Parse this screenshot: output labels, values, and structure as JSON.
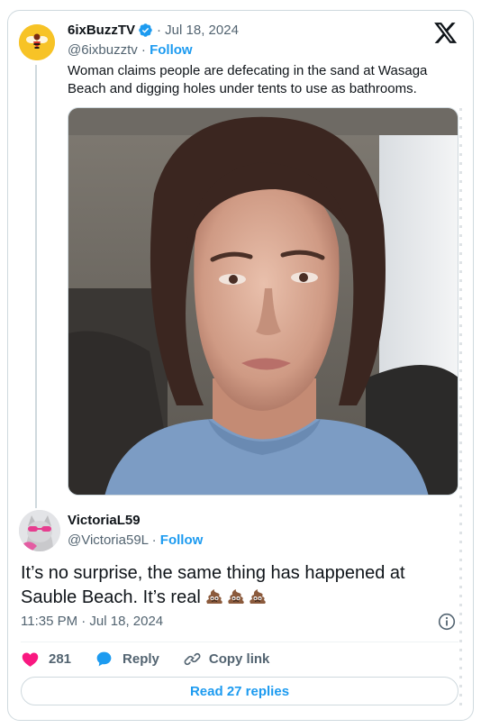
{
  "quoted": {
    "author_name": "6ixBuzzTV",
    "date_meta": "· Jul 18, 2024",
    "handle": "@6ixbuzztv",
    "dot": " · ",
    "follow_label": "Follow",
    "text": "Woman claims people are defecating in the sand at Wasaga Beach and digging holes under tents to use as bathrooms.",
    "avatar_icon": "bee-icon",
    "badge_icon": "verified-badge-icon"
  },
  "tweet": {
    "author_name": "VictoriaL59",
    "handle": "@Victoria59L",
    "dot": " · ",
    "follow_label": "Follow",
    "text": "It’s no surprise, the same thing has happened at Sauble Beach. It’s real",
    "emoji": [
      "pile-of-poo-icon",
      "pile-of-poo-icon",
      "pile-of-poo-icon"
    ],
    "timestamp": "11:35 PM · Jul 18, 2024"
  },
  "actions": {
    "like_count": "281",
    "reply_label": "Reply",
    "copy_label": "Copy link"
  },
  "footer": {
    "read_replies_label": "Read 27 replies"
  },
  "colors": {
    "accent": "#1d9bf0",
    "like": "#f91880",
    "text_primary": "#0f1419",
    "text_secondary": "#536471",
    "border": "#cfd9de"
  }
}
